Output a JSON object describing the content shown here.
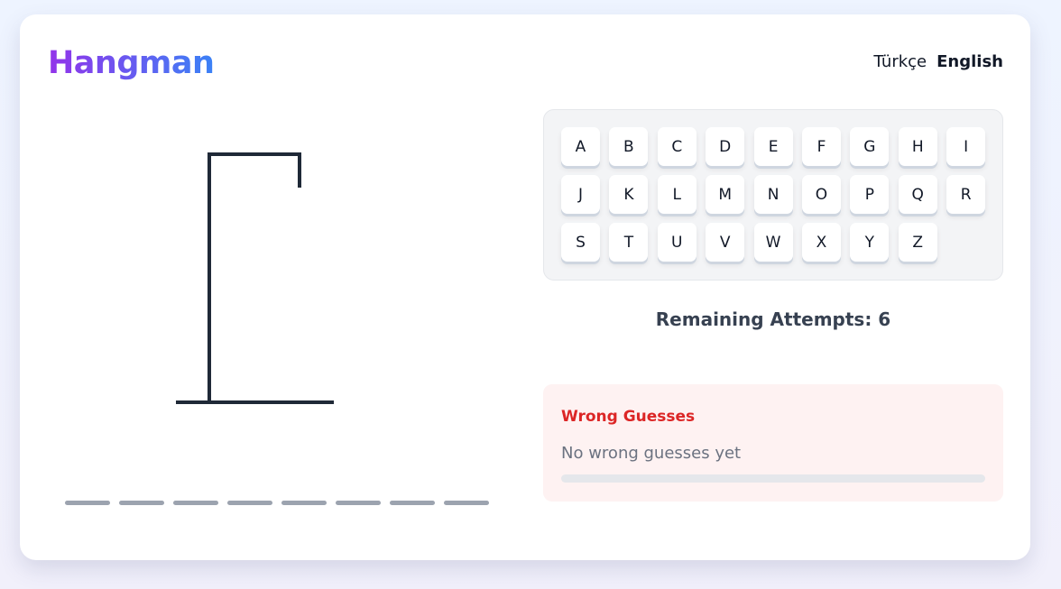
{
  "title": "Hangman",
  "languages": [
    {
      "label": "Türkçe",
      "active": false
    },
    {
      "label": "English",
      "active": true
    }
  ],
  "keyboard": [
    "A",
    "B",
    "C",
    "D",
    "E",
    "F",
    "G",
    "H",
    "I",
    "J",
    "K",
    "L",
    "M",
    "N",
    "O",
    "P",
    "Q",
    "R",
    "S",
    "T",
    "U",
    "V",
    "W",
    "X",
    "Y",
    "Z"
  ],
  "attempts": {
    "label": "Remaining Attempts:",
    "value": 6
  },
  "wrong_guesses": {
    "title": "Wrong Guesses",
    "empty_text": "No wrong guesses yet",
    "list": [],
    "progress_fraction": 0
  },
  "word": {
    "length": 8,
    "revealed": [
      "",
      "",
      "",
      "",
      "",
      "",
      "",
      ""
    ]
  },
  "colors": {
    "title_gradient_start": "#9333ea",
    "title_gradient_end": "#3b82f6",
    "gallows": "#1f2937",
    "wrong_accent": "#dc2626"
  }
}
